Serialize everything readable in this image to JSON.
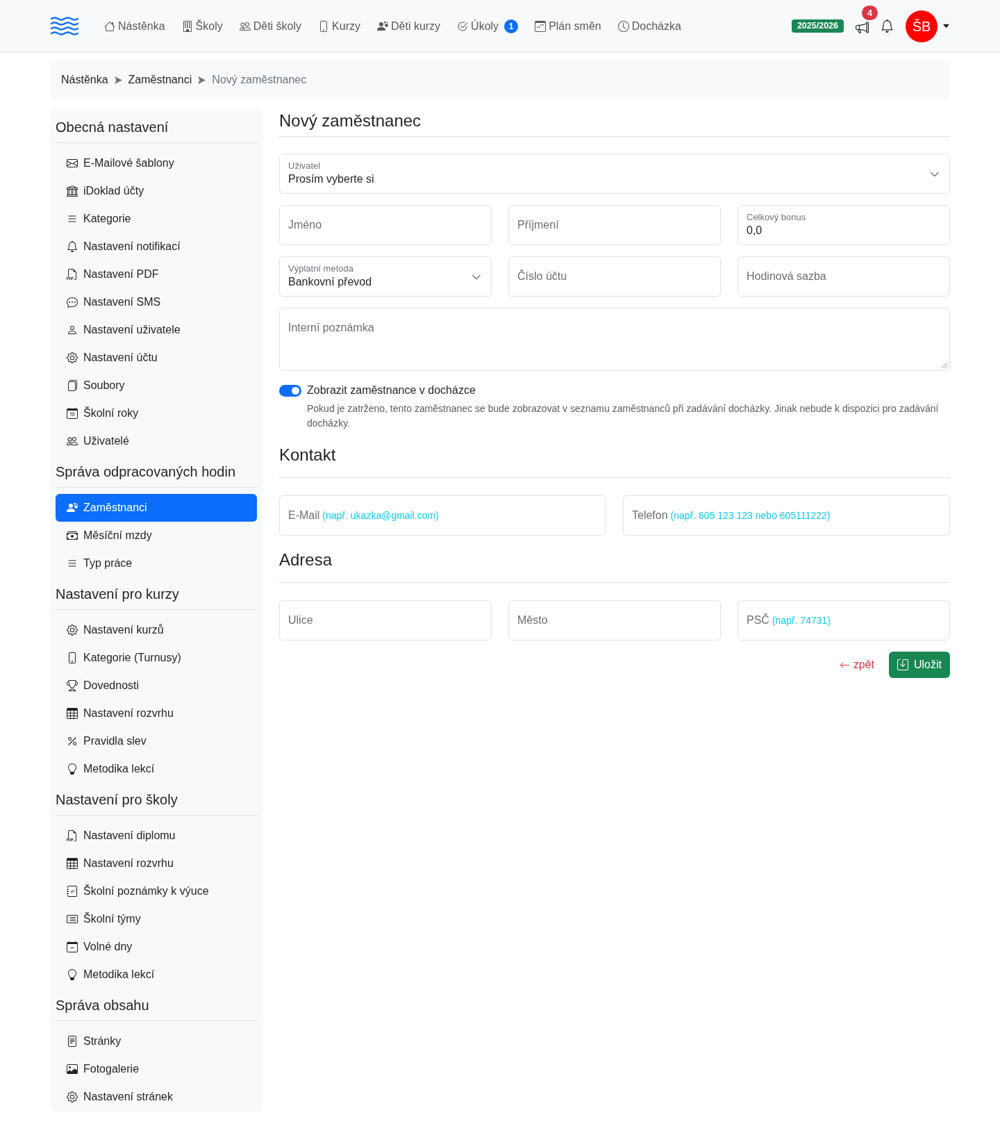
{
  "navbar": {
    "links": [
      {
        "label": "Nástěnka"
      },
      {
        "label": "Školy"
      },
      {
        "label": "Děti školy"
      },
      {
        "label": "Kurzy"
      },
      {
        "label": "Děti kurzy"
      },
      {
        "label": "Úkoly",
        "badge": "1"
      },
      {
        "label": "Plán směn"
      },
      {
        "label": "Docházka"
      }
    ],
    "school_year": "2025/2026",
    "announcements_badge": "4",
    "user_initials": "ŠB"
  },
  "breadcrumb": [
    {
      "label": "Nástěnka",
      "active": false
    },
    {
      "label": "Zaměstnanci",
      "active": false
    },
    {
      "label": "Nový zaměstnanec",
      "active": true
    }
  ],
  "sidebar": {
    "sections": [
      {
        "title": "Obecná nastavení",
        "items": [
          {
            "label": "E-Mailové šablony",
            "selected": false
          },
          {
            "label": "iDoklad účty",
            "selected": false
          },
          {
            "label": "Kategorie",
            "selected": false
          },
          {
            "label": "Nastavení notifikací",
            "selected": false
          },
          {
            "label": "Nastavení PDF",
            "selected": false
          },
          {
            "label": "Nastavení SMS",
            "selected": false
          },
          {
            "label": "Nastavení uživatele",
            "selected": false
          },
          {
            "label": "Nastavení účtu",
            "selected": false
          },
          {
            "label": "Soubory",
            "selected": false
          },
          {
            "label": "Školní roky",
            "selected": false
          },
          {
            "label": "Uživatelé",
            "selected": false
          }
        ]
      },
      {
        "title": "Správa odpracovaných hodin",
        "items": [
          {
            "label": "Zaměstnanci",
            "selected": true
          },
          {
            "label": "Měsíční mzdy",
            "selected": false
          },
          {
            "label": "Typ práce",
            "selected": false
          }
        ]
      },
      {
        "title": "Nastavení pro kurzy",
        "items": [
          {
            "label": "Nastavení kurzů",
            "selected": false
          },
          {
            "label": "Kategorie (Turnusy)",
            "selected": false
          },
          {
            "label": "Dovednosti",
            "selected": false
          },
          {
            "label": "Nastavení rozvrhu",
            "selected": false
          },
          {
            "label": "Pravidla slev",
            "selected": false
          },
          {
            "label": "Metodika lekcí",
            "selected": false
          }
        ]
      },
      {
        "title": "Nastavení pro školy",
        "items": [
          {
            "label": "Nastavení diplomu",
            "selected": false
          },
          {
            "label": "Nastavení rozvrhu",
            "selected": false
          },
          {
            "label": "Školní poznámky k výuce",
            "selected": false
          },
          {
            "label": "Školní týmy",
            "selected": false
          },
          {
            "label": "Volné dny",
            "selected": false
          },
          {
            "label": "Metodika lekcí",
            "selected": false
          }
        ]
      },
      {
        "title": "Správa obsahu",
        "items": [
          {
            "label": "Stránky",
            "selected": false
          },
          {
            "label": "Fotogalerie",
            "selected": false
          },
          {
            "label": "Nastavení stránek",
            "selected": false
          }
        ]
      }
    ]
  },
  "form": {
    "title": "Nový zaměstnanec",
    "user_select": {
      "kind": "select",
      "label": "Uživatel",
      "value": "Prosím vyberte si"
    },
    "rows": [
      [
        {
          "kind": "input",
          "placeholder": "Jméno"
        },
        {
          "kind": "input",
          "placeholder": "Příjmení"
        },
        {
          "kind": "input",
          "label": "Celkový bonus",
          "value": "0,0"
        }
      ],
      [
        {
          "kind": "select",
          "label": "Výplatní metoda",
          "value": "Bankovní převod"
        },
        {
          "kind": "input",
          "placeholder": "Číslo účtu"
        },
        {
          "kind": "input",
          "placeholder": "Hodinová sazba"
        }
      ]
    ],
    "note": {
      "placeholder": "Interní poznámka"
    },
    "attendance_toggle": {
      "label": "Zobrazit zaměstnance v docházce",
      "on": true,
      "help": "Pokud je zatrženo, tento zaměstnanec se bude zobrazovat v seznamu zaměstnanců při zadávání docházky. Jinak nebude k dispozici pro zadávání docházky."
    }
  },
  "contact": {
    "title": "Kontakt",
    "fields": [
      {
        "kind": "input",
        "placeholder": "E-Mail",
        "hint": "(např. ukazka@gmail.com)"
      },
      {
        "kind": "input",
        "placeholder": "Telefon",
        "hint": "(např. 605 123 123 nebo 605111222)"
      }
    ]
  },
  "address": {
    "title": "Adresa",
    "fields": [
      {
        "kind": "input",
        "placeholder": "Ulice"
      },
      {
        "kind": "input",
        "placeholder": "Město"
      },
      {
        "kind": "input",
        "placeholder": "PSČ",
        "hint": "(např. 74731)"
      }
    ]
  },
  "actions": {
    "back": "zpět",
    "save": "Uložit"
  }
}
